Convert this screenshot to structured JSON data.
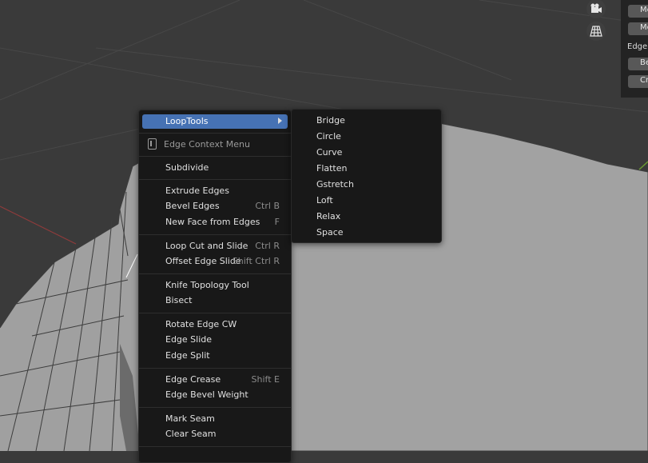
{
  "main_menu": {
    "loop_tools": "LoopTools",
    "context_title": "Edge Context Menu",
    "items": [
      {
        "label": "Subdivide",
        "shortcut": ""
      },
      {
        "label": "Extrude Edges",
        "shortcut": ""
      },
      {
        "label": "Bevel Edges",
        "shortcut": "Ctrl B"
      },
      {
        "label": "New Face from Edges",
        "shortcut": "F"
      },
      {
        "label": "Loop Cut and Slide",
        "shortcut": "Ctrl R"
      },
      {
        "label": "Offset Edge Slide",
        "shortcut": "Shift Ctrl R"
      },
      {
        "label": "Knife Topology Tool",
        "shortcut": ""
      },
      {
        "label": "Bisect",
        "shortcut": ""
      },
      {
        "label": "Rotate Edge CW",
        "shortcut": ""
      },
      {
        "label": "Edge Slide",
        "shortcut": ""
      },
      {
        "label": "Edge Split",
        "shortcut": ""
      },
      {
        "label": "Edge Crease",
        "shortcut": "Shift E"
      },
      {
        "label": "Edge Bevel Weight",
        "shortcut": ""
      },
      {
        "label": "Mark Seam",
        "shortcut": ""
      },
      {
        "label": "Clear Seam",
        "shortcut": ""
      }
    ]
  },
  "submenu": {
    "items": [
      "Bridge",
      "Circle",
      "Curve",
      "Flatten",
      "Gstretch",
      "Loft",
      "Relax",
      "Space"
    ]
  },
  "side_panel": {
    "buttons": [
      "Me",
      "Me",
      "Be",
      "Cr"
    ],
    "edge_label": "Edge"
  },
  "icons": [
    "camera-icon",
    "grid-icon",
    "edge-menu-icon",
    "submenu-arrow-icon"
  ],
  "colors": {
    "highlight": "#4672b4",
    "menu_bg": "#181818",
    "viewport_bg": "#3a3a3a",
    "mesh": "#a2a2a2"
  }
}
